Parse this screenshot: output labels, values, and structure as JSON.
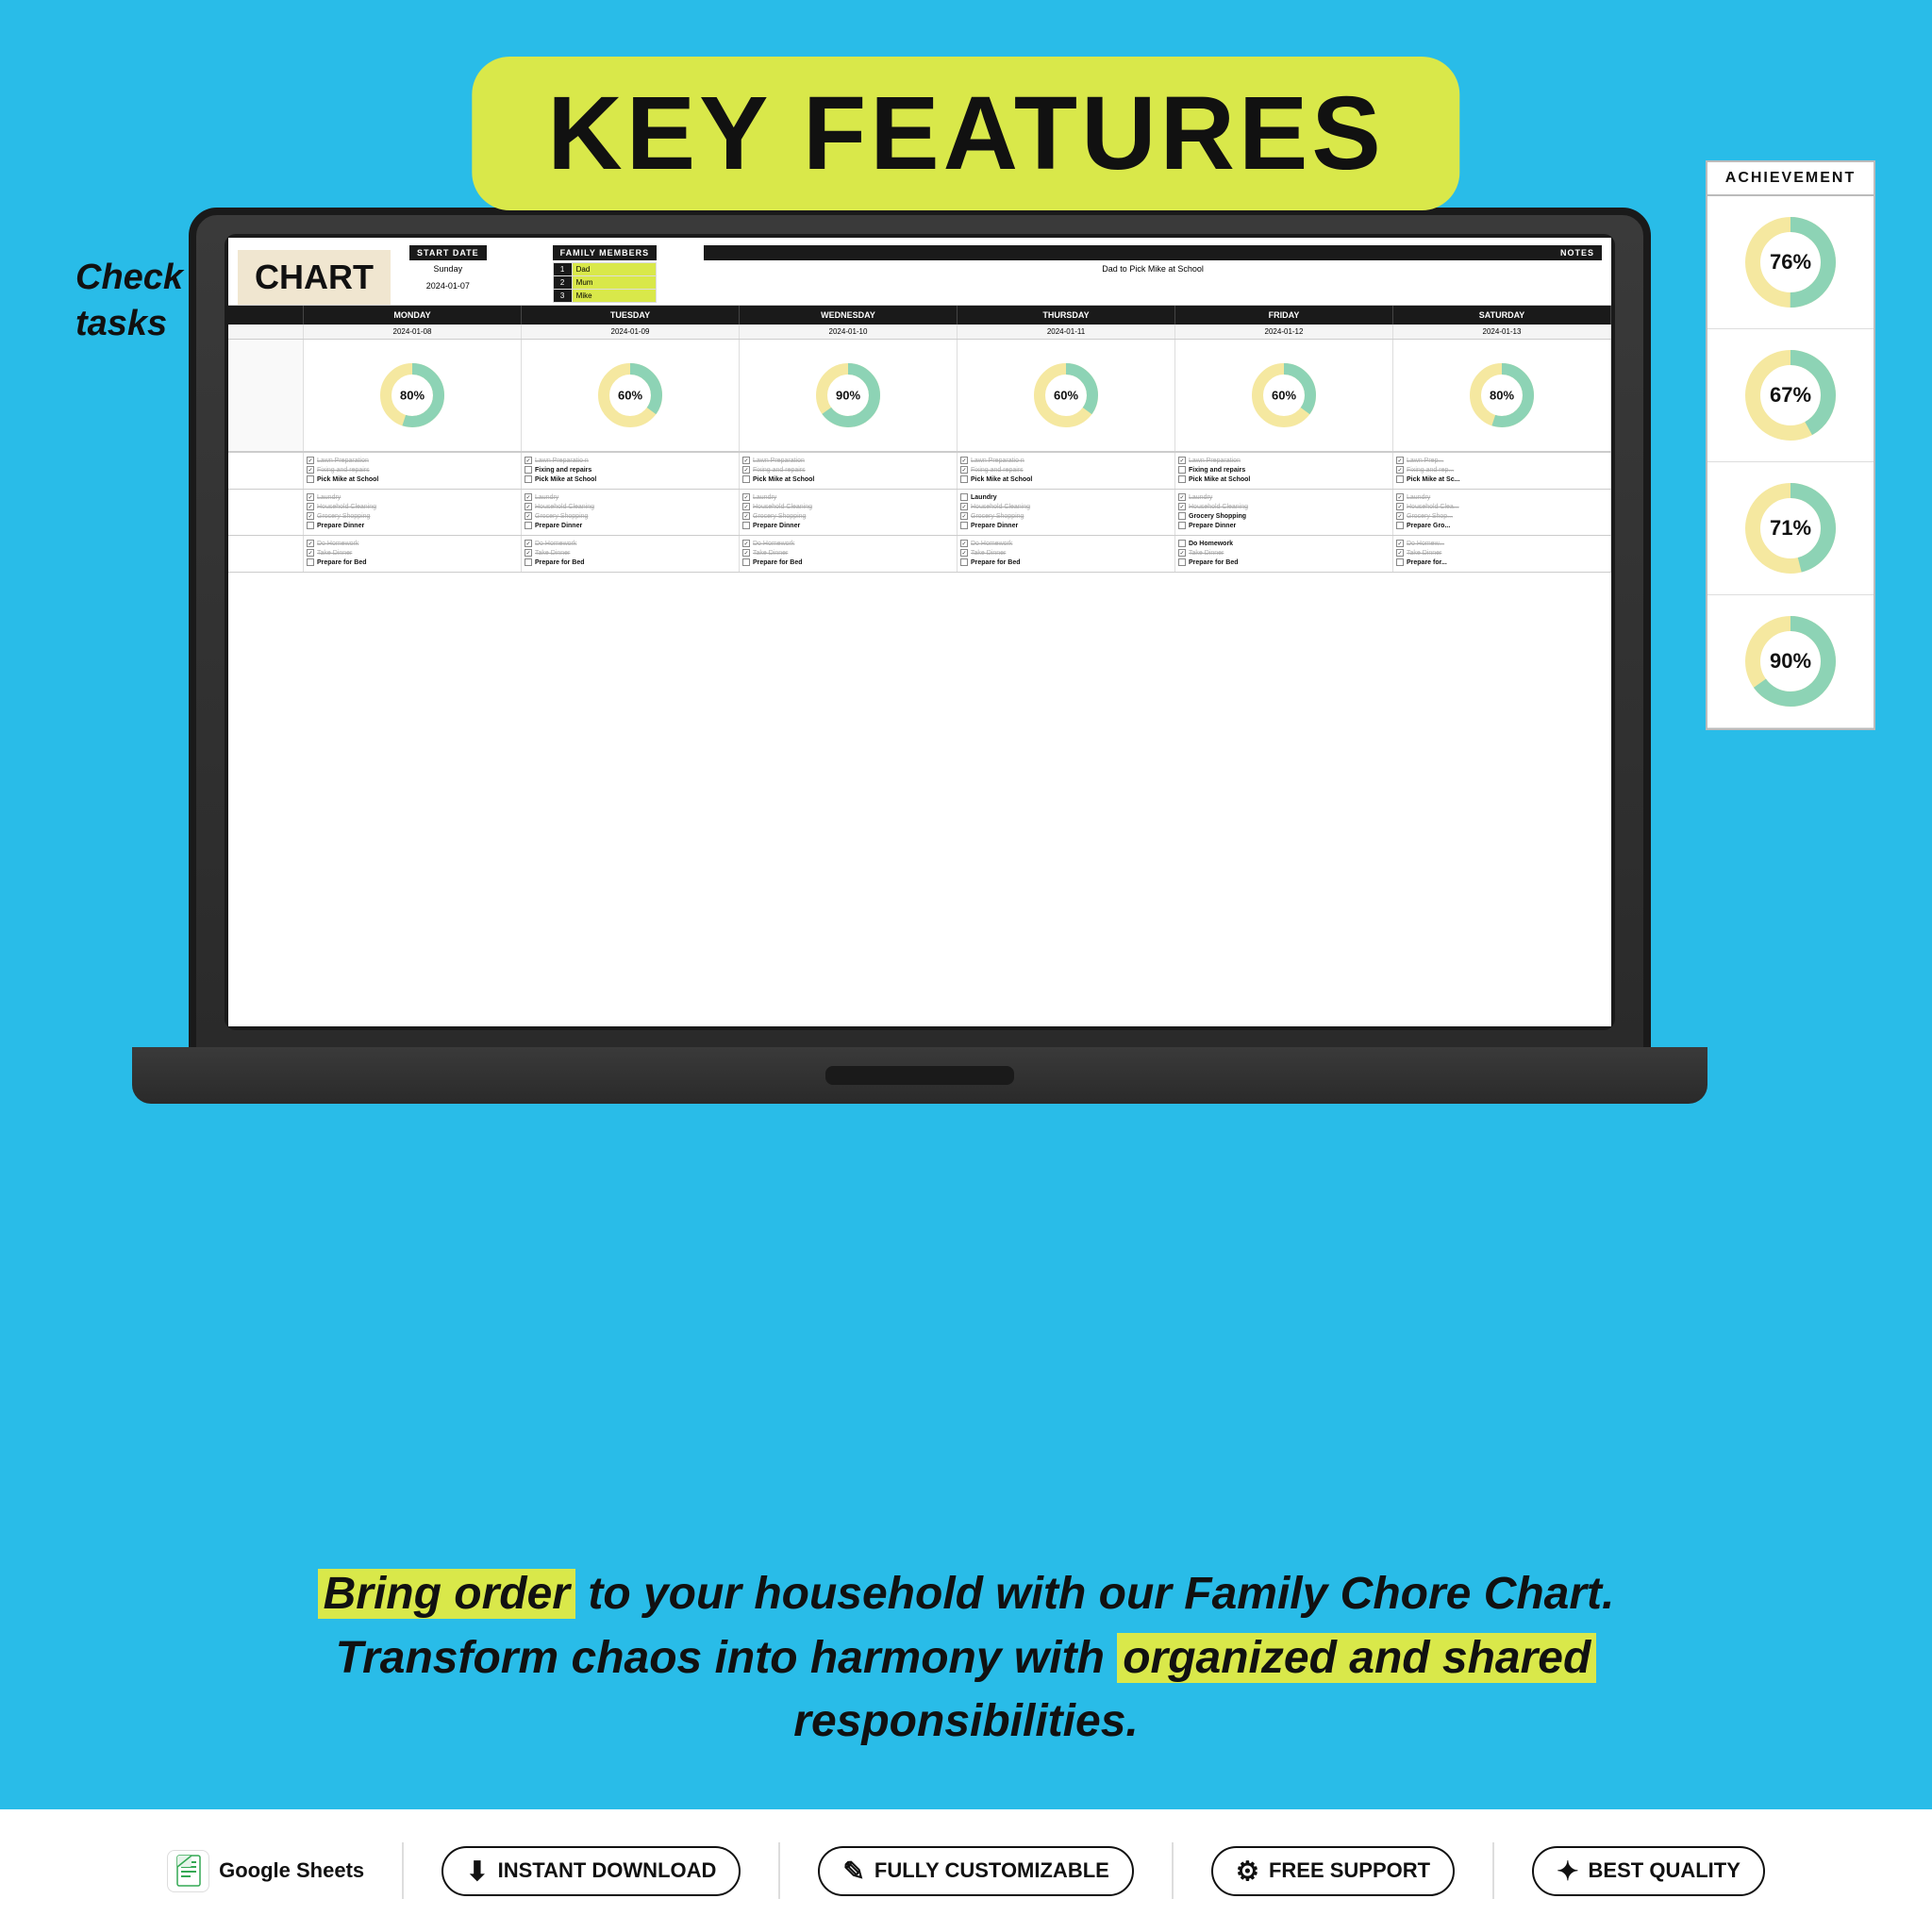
{
  "page": {
    "title": "KEY FEATURES",
    "background_color": "#29bce8"
  },
  "banner": {
    "text": "KEY FEATURES"
  },
  "sidebar_label": {
    "line1": "Check your daily",
    "line2": "tasks"
  },
  "achievement_panel": {
    "title": "ACHIEVEMENT",
    "cards": [
      {
        "percent": "76%",
        "value": 76
      },
      {
        "percent": "67%",
        "value": 67
      },
      {
        "percent": "71%",
        "value": 71
      },
      {
        "percent": "90%",
        "value": 90
      }
    ]
  },
  "spreadsheet": {
    "chart_label": "CHART",
    "start_date_label": "START DATE",
    "start_day": "Sunday",
    "start_date": "2024-01-07",
    "family_members_label": "FAMILY MEMBERS",
    "members": [
      {
        "num": "1",
        "name": "Dad"
      },
      {
        "num": "2",
        "name": "Mum"
      },
      {
        "num": "3",
        "name": "Mike"
      }
    ],
    "notes_label": "NOTES",
    "notes_text": "Dad to Pick Mike at School",
    "days": [
      "MONDAY",
      "TUESDAY",
      "WEDNESDAY",
      "THURSDAY",
      "FRIDAY",
      "SATURDAY"
    ],
    "dates": [
      "2024-01-08",
      "2024-01-09",
      "2024-01-10",
      "2024-01-11",
      "2024-01-12",
      "2024-01-13"
    ],
    "progress": [
      {
        "label": "80%",
        "value": 80
      },
      {
        "label": "60%",
        "value": 60
      },
      {
        "label": "90%",
        "value": 90
      },
      {
        "label": "60%",
        "value": 60
      },
      {
        "label": "60%",
        "value": 60
      },
      {
        "label": "80%",
        "value": 80
      }
    ],
    "task_rows": [
      {
        "tasks": [
          {
            "done": true,
            "text": "Lawn Preparation"
          },
          {
            "done": true,
            "text": "Fixing and repairs"
          },
          {
            "done": false,
            "text": "Pick Mike at School"
          }
        ]
      },
      {
        "tasks": [
          {
            "done": true,
            "text": "Laundry"
          },
          {
            "done": true,
            "text": "Household Cleaning"
          },
          {
            "done": true,
            "text": "Grocery Shopping"
          },
          {
            "done": false,
            "text": "Prepare Dinner"
          }
        ]
      },
      {
        "tasks": [
          {
            "done": true,
            "text": "Do Homework"
          },
          {
            "done": true,
            "text": "Take Dinner"
          },
          {
            "done": false,
            "text": "Prepare for Bed"
          }
        ]
      }
    ]
  },
  "bottom_text": {
    "line1_highlight": "Bring order",
    "line1_rest": " to your household with our Family Chore Chart.",
    "line2": "Transform chaos into harmony with ",
    "line2_highlight": "organized and shared",
    "line3": "responsibilities."
  },
  "footer": {
    "items": [
      {
        "icon": "📊",
        "label": "Google Sheets",
        "type": "google"
      },
      {
        "icon": "⬇",
        "label": "INSTANT DOWNLOAD",
        "type": "badge"
      },
      {
        "icon": "✎",
        "label": "FULLY CUSTOMIZABLE",
        "type": "badge"
      },
      {
        "icon": "⚙",
        "label": "FREE SUPPORT",
        "type": "badge"
      },
      {
        "icon": "✦",
        "label": "BEST QUALITY",
        "type": "badge"
      }
    ]
  }
}
